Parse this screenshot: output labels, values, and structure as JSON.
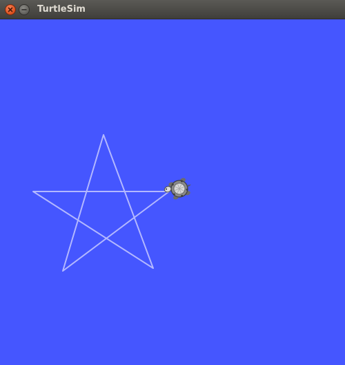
{
  "window": {
    "title": "TurtleSim",
    "close_icon": "close-icon",
    "minimize_icon": "minimize-icon"
  },
  "canvas": {
    "background_color": "#4556ff",
    "pen_color": "#b3b8ff",
    "path_shape": "five-pointed star",
    "turtle_icon": "turtle-icon"
  }
}
